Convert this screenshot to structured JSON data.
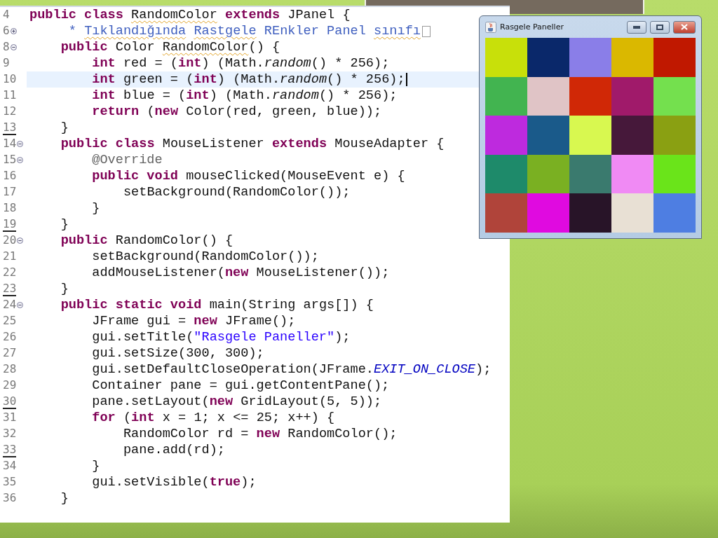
{
  "editor": {
    "lines": [
      {
        "number": "4",
        "marked": false,
        "current": false,
        "tokens": [
          {
            "kind": "kw",
            "t": "public class"
          },
          {
            "kind": "txt",
            "t": " RandomColor",
            "warn": true
          },
          {
            "kind": "kw",
            "t": " extends"
          },
          {
            "kind": "txt",
            "t": " JPanel {"
          }
        ]
      },
      {
        "number": "6",
        "collapsible": true,
        "expanded": false,
        "marked": false,
        "current": false,
        "folded": true,
        "tokens": [
          {
            "kind": "doc",
            "t": "     *"
          },
          {
            "kind": "doc",
            "t": " Tıklandığında",
            "warn": true
          },
          {
            "kind": "doc",
            "t": " Rastgele",
            "warn": true
          },
          {
            "kind": "doc",
            "t": " REnkler Panel"
          },
          {
            "kind": "doc",
            "t": " sınıfı",
            "warn": true
          }
        ]
      },
      {
        "number": "8",
        "collapsible": true,
        "expanded": true,
        "marked": false,
        "current": false,
        "tokens": [
          {
            "kind": "kw",
            "t": "    public"
          },
          {
            "kind": "txt",
            "t": " Color"
          },
          {
            "kind": "txt",
            "t": " RandomColor",
            "warn": true
          },
          {
            "kind": "txt",
            "t": "() {"
          }
        ]
      },
      {
        "number": "9",
        "marked": false,
        "current": false,
        "tokens": [
          {
            "kind": "kw",
            "t": "        int"
          },
          {
            "kind": "txt",
            "t": " red = ("
          },
          {
            "kind": "kw",
            "t": "int"
          },
          {
            "kind": "txt",
            "t": ") (Math."
          },
          {
            "kind": "ital",
            "t": "random"
          },
          {
            "kind": "txt",
            "t": "() * 256);"
          }
        ]
      },
      {
        "number": "10",
        "marked": false,
        "current": true,
        "tokens": [
          {
            "kind": "kw",
            "t": "        int"
          },
          {
            "kind": "txt",
            "t": " green = ("
          },
          {
            "kind": "kw",
            "t": "int"
          },
          {
            "kind": "txt",
            "t": ") (Math."
          },
          {
            "kind": "ital",
            "t": "random"
          },
          {
            "kind": "txt",
            "t": "() * 256);"
          }
        ]
      },
      {
        "number": "11",
        "marked": false,
        "current": false,
        "tokens": [
          {
            "kind": "kw",
            "t": "        int"
          },
          {
            "kind": "txt",
            "t": " blue = ("
          },
          {
            "kind": "kw",
            "t": "int"
          },
          {
            "kind": "txt",
            "t": ") (Math."
          },
          {
            "kind": "ital",
            "t": "random"
          },
          {
            "kind": "txt",
            "t": "() * 256);"
          }
        ]
      },
      {
        "number": "12",
        "marked": false,
        "current": false,
        "tokens": [
          {
            "kind": "kw",
            "t": "        return"
          },
          {
            "kind": "txt",
            "t": " ("
          },
          {
            "kind": "kw",
            "t": "new"
          },
          {
            "kind": "txt",
            "t": " Color(red, green, blue));"
          }
        ]
      },
      {
        "number": "13",
        "marked": true,
        "current": false,
        "tokens": [
          {
            "kind": "txt",
            "t": "    }"
          }
        ]
      },
      {
        "number": "14",
        "collapsible": true,
        "expanded": true,
        "marked": false,
        "current": false,
        "tokens": [
          {
            "kind": "kw",
            "t": "    public class"
          },
          {
            "kind": "txt",
            "t": " MouseListener"
          },
          {
            "kind": "kw",
            "t": " extends"
          },
          {
            "kind": "txt",
            "t": " MouseAdapter {"
          }
        ]
      },
      {
        "number": "15",
        "collapsible": true,
        "expanded": true,
        "marked": false,
        "current": false,
        "tokens": [
          {
            "kind": "anno",
            "t": "        @Override"
          }
        ]
      },
      {
        "number": "16",
        "marked": false,
        "current": false,
        "tokens": [
          {
            "kind": "kw",
            "t": "        public void"
          },
          {
            "kind": "txt",
            "t": " mouseClicked(MouseEvent e) {"
          }
        ]
      },
      {
        "number": "17",
        "marked": false,
        "current": false,
        "tokens": [
          {
            "kind": "txt",
            "t": "            setBackground(RandomColor());"
          }
        ]
      },
      {
        "number": "18",
        "marked": false,
        "current": false,
        "tokens": [
          {
            "kind": "txt",
            "t": "        }"
          }
        ]
      },
      {
        "number": "19",
        "marked": true,
        "current": false,
        "tokens": [
          {
            "kind": "txt",
            "t": "    }"
          }
        ]
      },
      {
        "number": "20",
        "collapsible": true,
        "expanded": true,
        "marked": false,
        "current": false,
        "tokens": [
          {
            "kind": "kw",
            "t": "    public"
          },
          {
            "kind": "txt",
            "t": " RandomColor() {"
          }
        ]
      },
      {
        "number": "21",
        "marked": false,
        "current": false,
        "tokens": [
          {
            "kind": "txt",
            "t": "        setBackground(RandomColor());"
          }
        ]
      },
      {
        "number": "22",
        "marked": false,
        "current": false,
        "tokens": [
          {
            "kind": "txt",
            "t": "        addMouseListener("
          },
          {
            "kind": "kw",
            "t": "new"
          },
          {
            "kind": "txt",
            "t": " MouseListener());"
          }
        ]
      },
      {
        "number": "23",
        "marked": true,
        "current": false,
        "tokens": [
          {
            "kind": "txt",
            "t": "    }"
          }
        ]
      },
      {
        "number": "24",
        "collapsible": true,
        "expanded": true,
        "marked": false,
        "current": false,
        "tokens": [
          {
            "kind": "kw",
            "t": "    public static void"
          },
          {
            "kind": "txt",
            "t": " main(String args[]) {"
          }
        ]
      },
      {
        "number": "25",
        "marked": false,
        "current": false,
        "tokens": [
          {
            "kind": "txt",
            "t": "        JFrame gui ="
          },
          {
            "kind": "kw",
            "t": " new"
          },
          {
            "kind": "txt",
            "t": " JFrame();"
          }
        ]
      },
      {
        "number": "26",
        "marked": false,
        "current": false,
        "tokens": [
          {
            "kind": "txt",
            "t": "        gui.setTitle("
          },
          {
            "kind": "str",
            "t": "\"Rasgele Paneller\""
          },
          {
            "kind": "txt",
            "t": ");"
          }
        ]
      },
      {
        "number": "27",
        "marked": false,
        "current": false,
        "tokens": [
          {
            "kind": "txt",
            "t": "        gui.setSize(300, 300);"
          }
        ]
      },
      {
        "number": "28",
        "marked": false,
        "current": false,
        "tokens": [
          {
            "kind": "txt",
            "t": "        gui.setDefaultCloseOperation(JFrame."
          },
          {
            "kind": "const",
            "t": "EXIT_ON_CLOSE"
          },
          {
            "kind": "txt",
            "t": ");"
          }
        ]
      },
      {
        "number": "29",
        "marked": false,
        "current": false,
        "tokens": [
          {
            "kind": "txt",
            "t": "        Container pane = gui.getContentPane();"
          }
        ]
      },
      {
        "number": "30",
        "marked": true,
        "current": false,
        "tokens": [
          {
            "kind": "txt",
            "t": "        pane.setLayout("
          },
          {
            "kind": "kw",
            "t": "new"
          },
          {
            "kind": "txt",
            "t": " GridLayout(5, 5));"
          }
        ]
      },
      {
        "number": "31",
        "marked": false,
        "current": false,
        "tokens": [
          {
            "kind": "kw",
            "t": "        for"
          },
          {
            "kind": "txt",
            "t": " ("
          },
          {
            "kind": "kw",
            "t": "int"
          },
          {
            "kind": "txt",
            "t": " x = 1; x <= 25; x++) {"
          }
        ]
      },
      {
        "number": "32",
        "marked": false,
        "current": false,
        "tokens": [
          {
            "kind": "txt",
            "t": "            RandomColor rd ="
          },
          {
            "kind": "kw",
            "t": " new"
          },
          {
            "kind": "txt",
            "t": " RandomColor();"
          }
        ]
      },
      {
        "number": "33",
        "marked": true,
        "current": false,
        "tokens": [
          {
            "kind": "txt",
            "t": "            pane.add(rd);"
          }
        ]
      },
      {
        "number": "34",
        "marked": false,
        "current": false,
        "tokens": [
          {
            "kind": "txt",
            "t": "        }"
          }
        ]
      },
      {
        "number": "35",
        "marked": false,
        "current": false,
        "tokens": [
          {
            "kind": "txt",
            "t": "        gui.setVisible("
          },
          {
            "kind": "kw",
            "t": "true"
          },
          {
            "kind": "txt",
            "t": ");"
          }
        ]
      },
      {
        "number": "36",
        "marked": false,
        "current": false,
        "tokens": [
          {
            "kind": "txt",
            "t": "    }"
          }
        ]
      }
    ]
  },
  "window": {
    "title": "Rasgele Paneller",
    "panels": [
      {
        "color": "#c8e00a"
      },
      {
        "color": "#0a286a"
      },
      {
        "color": "#8a7ee8"
      },
      {
        "color": "#dab800"
      },
      {
        "color": "#c01800"
      },
      {
        "color": "#42b450"
      },
      {
        "color": "#e0c4c6"
      },
      {
        "color": "#d02806"
      },
      {
        "color": "#a01a6a"
      },
      {
        "color": "#74e04e"
      },
      {
        "color": "#be2ade"
      },
      {
        "color": "#1a5a8a"
      },
      {
        "color": "#d8f850"
      },
      {
        "color": "#46183a"
      },
      {
        "color": "#8aa012"
      },
      {
        "color": "#1e8a6a"
      },
      {
        "color": "#7ab022"
      },
      {
        "color": "#3a7a6e"
      },
      {
        "color": "#f08af4"
      },
      {
        "color": "#6ae41a"
      },
      {
        "color": "#b0443a"
      },
      {
        "color": "#e00ae0"
      },
      {
        "color": "#281428"
      },
      {
        "color": "#e8e0d4"
      },
      {
        "color": "#4e7ee2"
      }
    ]
  }
}
